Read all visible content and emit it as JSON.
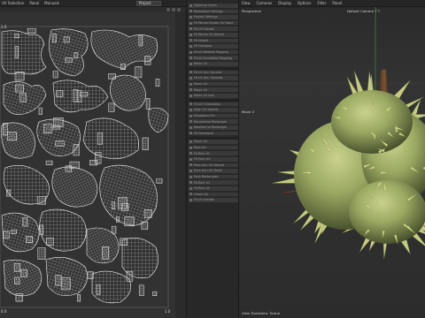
{
  "uv_editor": {
    "menu": [
      "UV Selection",
      "Panel",
      "Manuals"
    ],
    "project_select": "Project",
    "axis_top": "1.0",
    "axis_bottom": "0.0",
    "axis_right": "1.0"
  },
  "tools": {
    "items": [
      "Optimize Faces",
      "Relaxation Settings",
      "Project Settings",
      "Fit Whole Cluster UV Slant",
      "Fit UV Islands",
      "Fit Whole UV Islands",
      "Fit Height",
      "Fit Triangles",
      "Fit UV Related Mapping",
      "Fit UV Unrelated Mapping",
      "Relax UV",
      "Fit UV Ann Unrelat",
      "Fit UV Ann Forward",
      "Relax UV",
      "Relax UV",
      "Relax UV Ann",
      "Fit UV Orientation",
      "Align UV Islands",
      "Straighten UV",
      "Randomize Rectangle",
      "Reselect to Rectangle",
      "Fit Transform",
      "Stack UV",
      "Pack UV",
      "Fit Rect UV",
      "Fit Pack UV",
      "Pack Ann UV Islands",
      "Pack Ann UV Rects",
      "Pack Rectangles",
      "Fit Rect UV",
      "Fit Rect UV",
      "Orient UV",
      "Fit UV Islands"
    ]
  },
  "viewport": {
    "menu": [
      "View",
      "Cameras",
      "Display",
      "Options",
      "Filter",
      "Panel"
    ],
    "view_label": "Perspective",
    "camera_label": "Default Camera ↑↑",
    "axis_label": "Move ↕",
    "status_label": "View Transform: Scene"
  },
  "colors": {
    "uv_background": "#323232",
    "uv_wire": "#d8d8d8",
    "viewport_background": "#303030",
    "mesh_green": "#9aa862",
    "stem_brown": "#6b4a2e",
    "axis_red": "#c0392b",
    "axis_green": "#3f9d4a"
  }
}
